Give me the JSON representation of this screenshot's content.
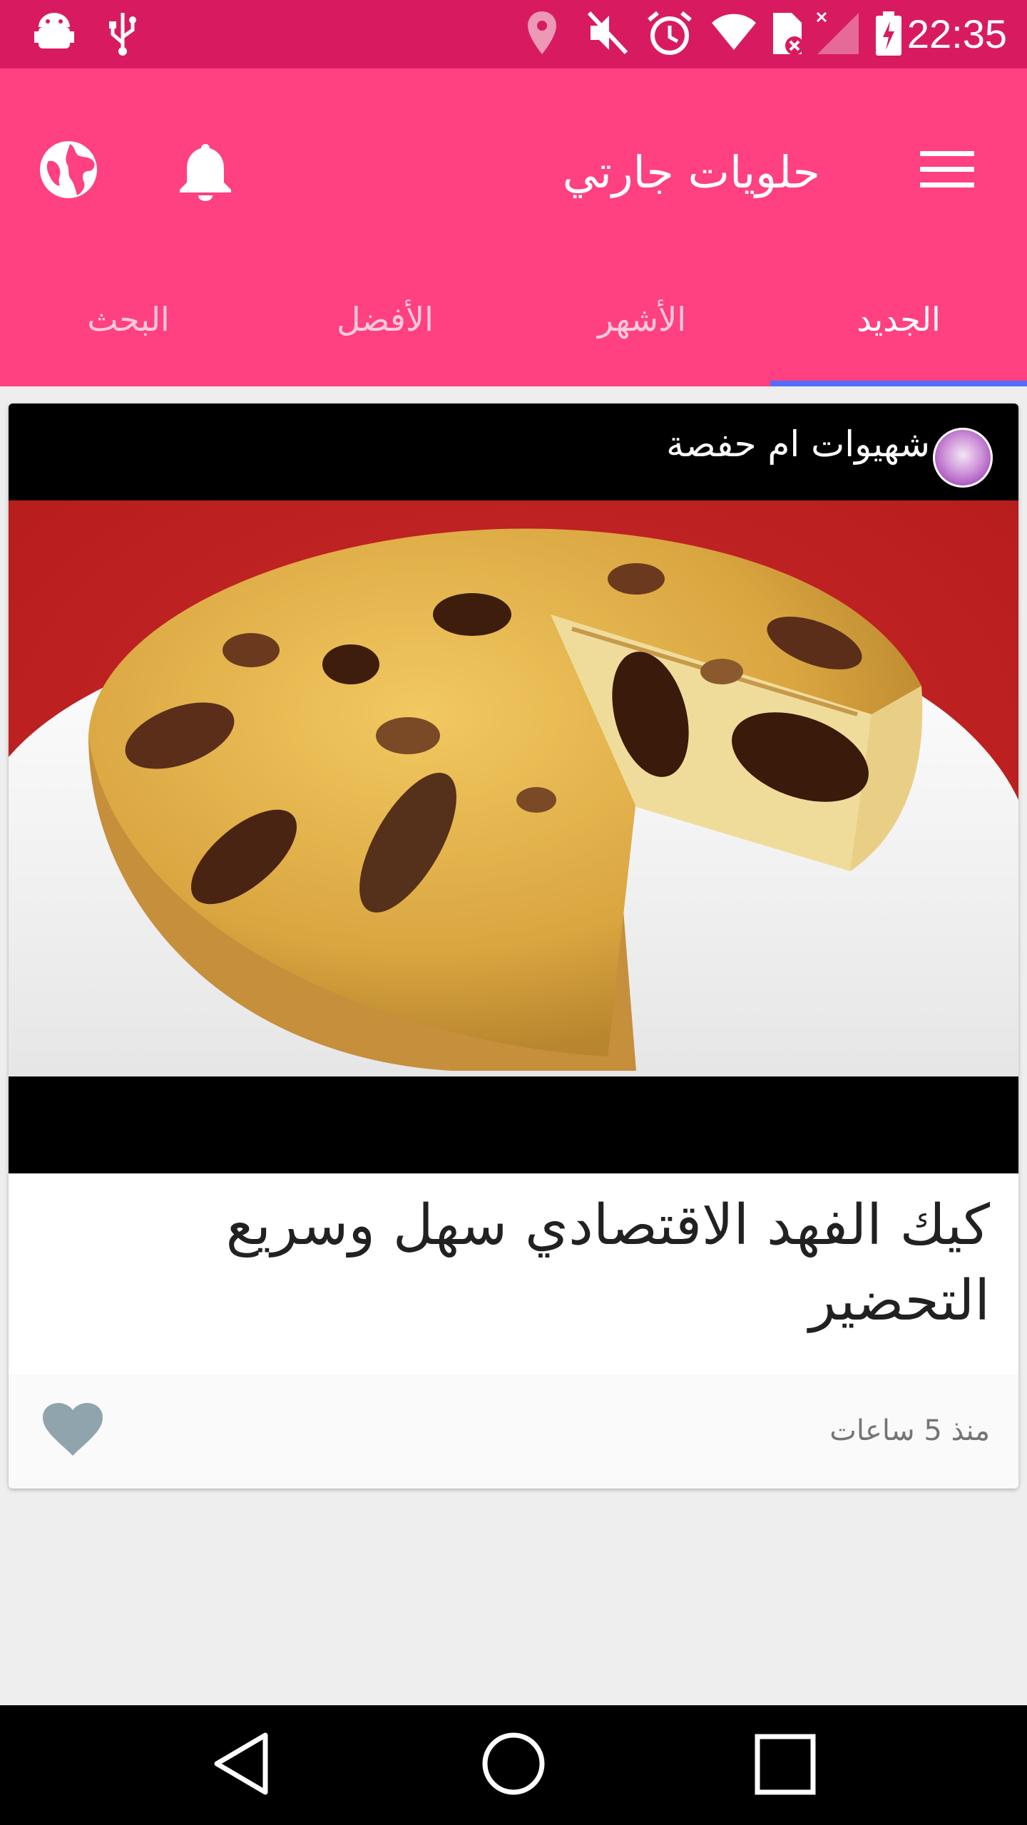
{
  "status_bar": {
    "time": "22:35",
    "left_icons": [
      "android-debug-icon",
      "usb-icon"
    ],
    "right_icons": [
      "location-icon",
      "mute-icon",
      "alarm-icon",
      "wifi-icon",
      "sim-error-icon",
      "signal-icon",
      "battery-charging-icon"
    ],
    "background": "#d81b60"
  },
  "app_bar": {
    "title": "حلويات جارتي",
    "background": "#ff4081",
    "menu_icon": "hamburger-menu-icon",
    "notification_icon": "bell-icon",
    "language_icon": "globe-icon"
  },
  "tabs": [
    {
      "label": "الجديد",
      "active": true
    },
    {
      "label": "الأشهر",
      "active": false
    },
    {
      "label": "الأفضل",
      "active": false
    },
    {
      "label": "البحث",
      "active": false
    }
  ],
  "tab_indicator_color": "#536dfe",
  "post": {
    "author": "شهيوات ام حفصة",
    "title": "كيك الفهد الاقتصادي سهل وسريع التحضير",
    "time_ago": "منذ 5 ساعات",
    "like_icon": "heart-icon",
    "image_subject": "cake-photo"
  },
  "nav_bar": {
    "buttons": [
      "back-icon",
      "home-icon",
      "recents-icon"
    ]
  }
}
